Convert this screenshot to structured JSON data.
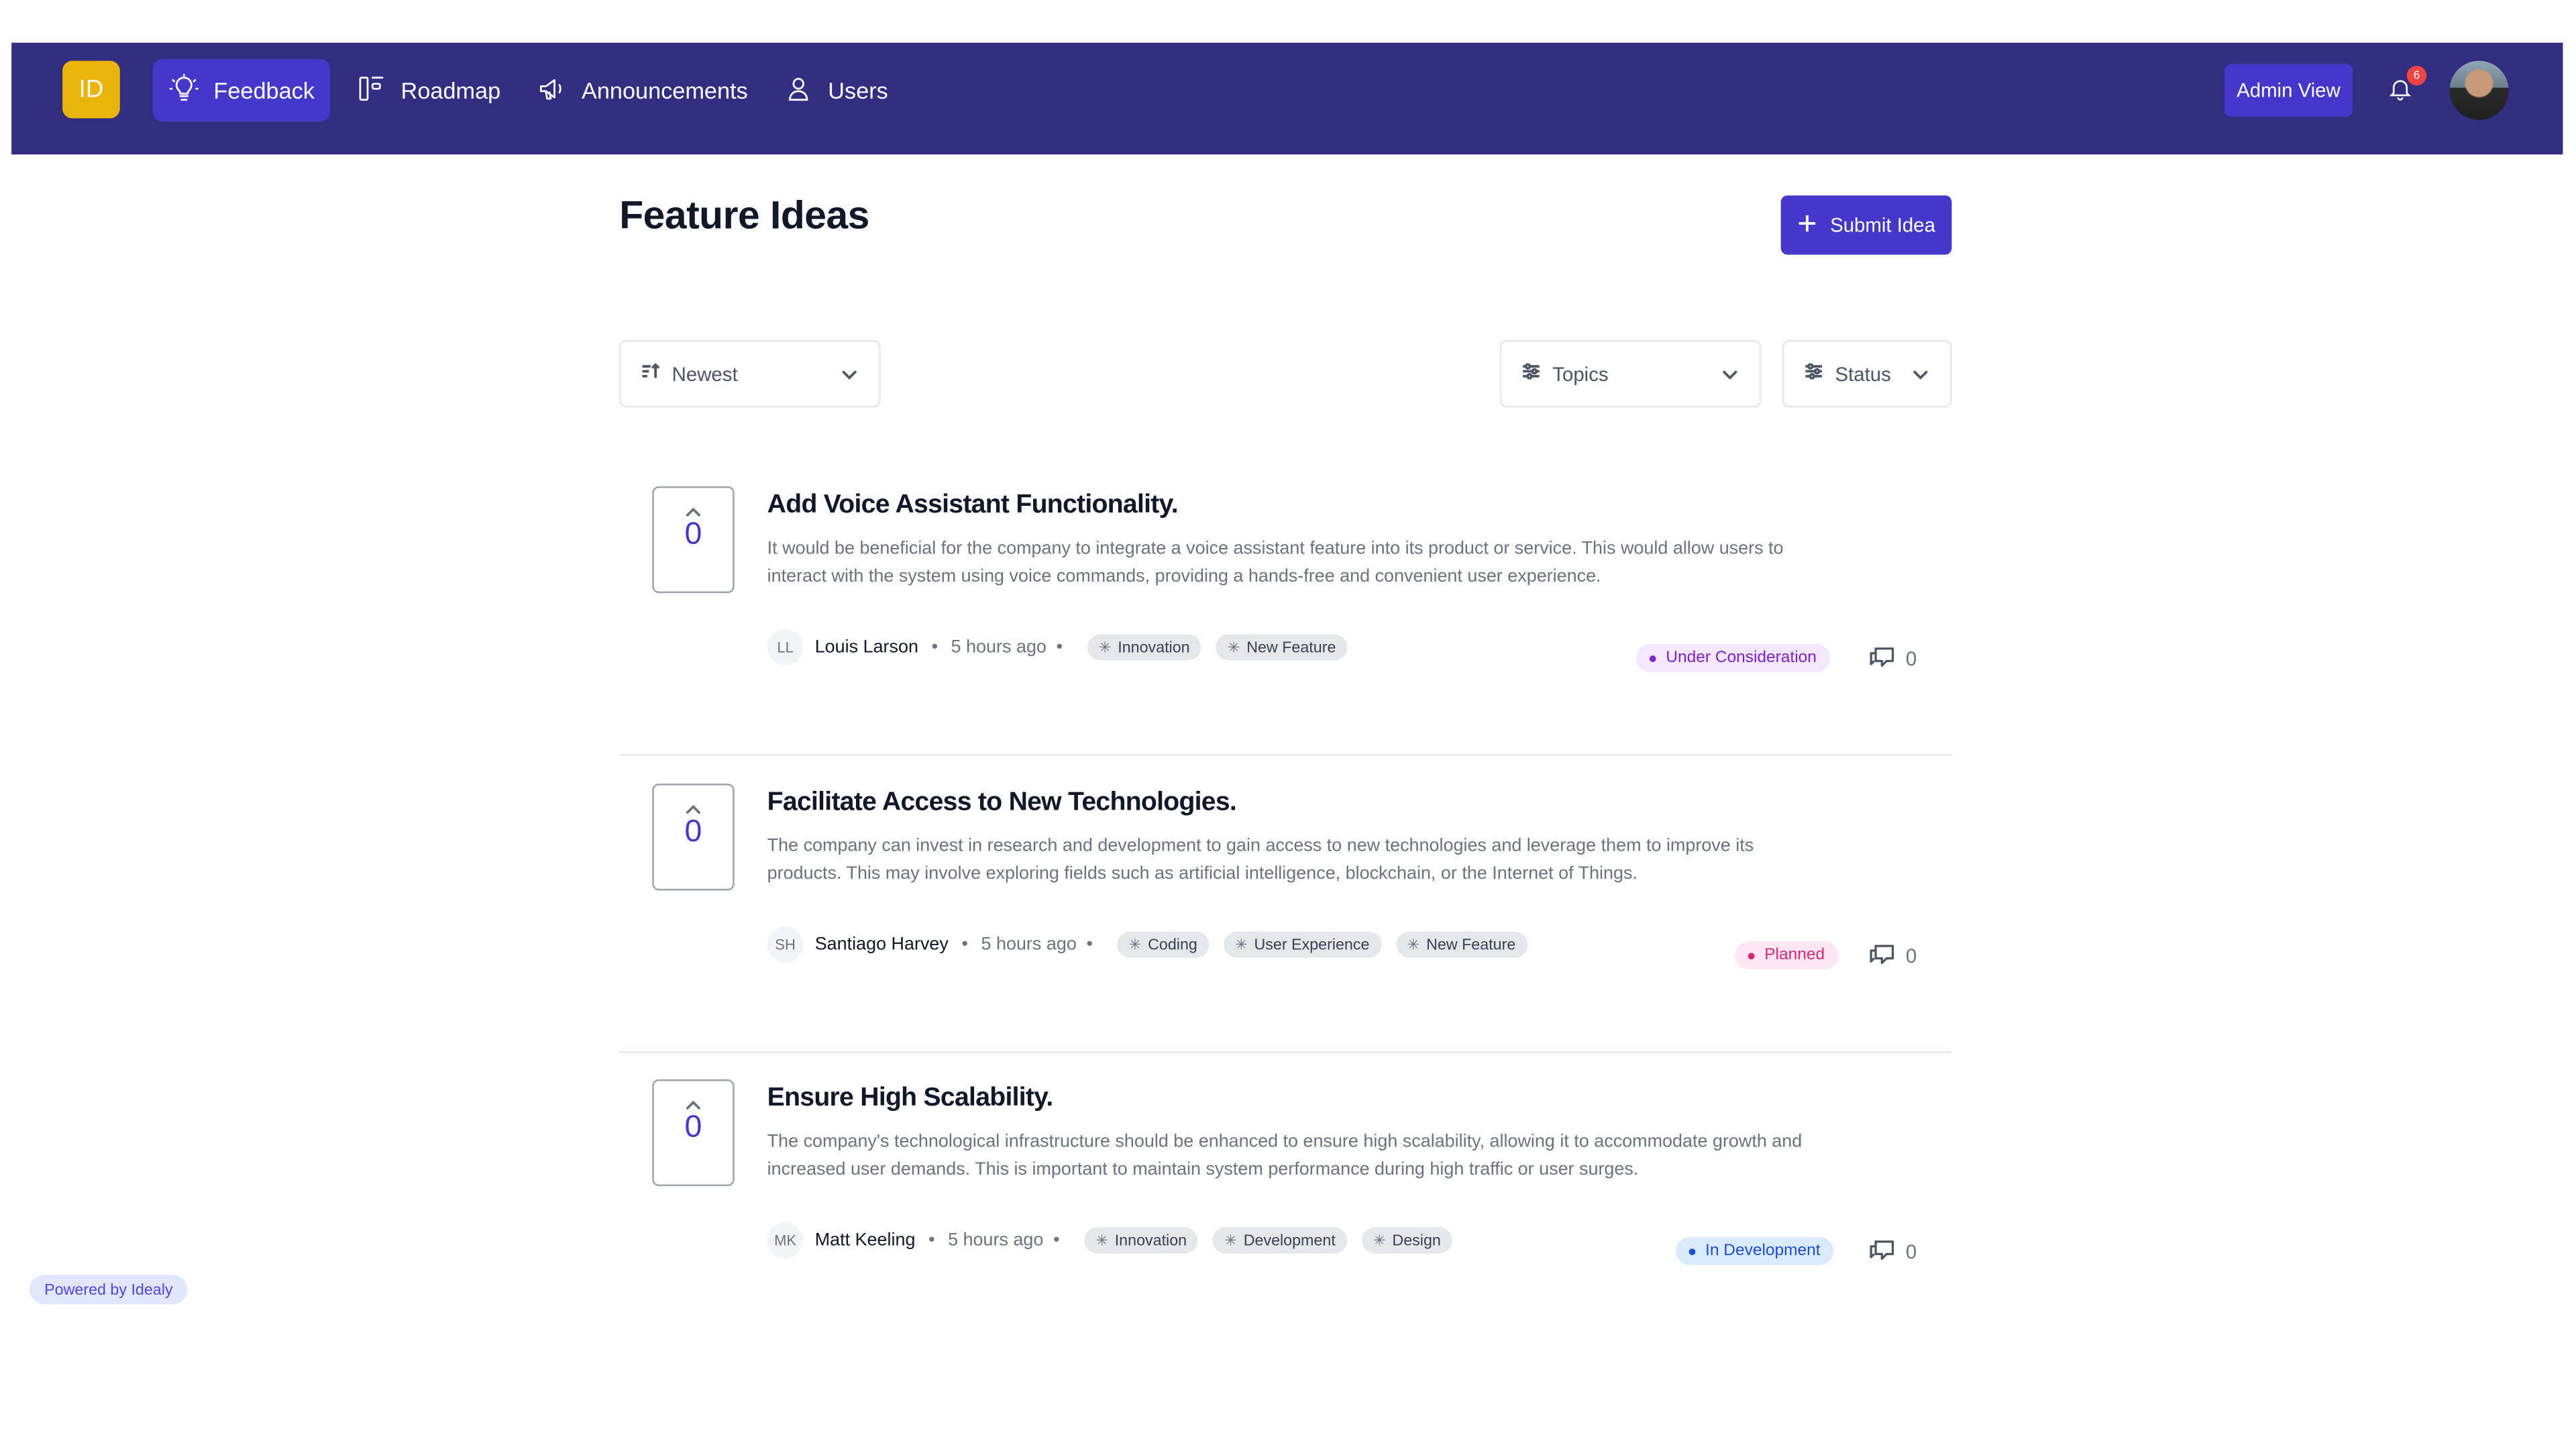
{
  "nav": {
    "logo": "ID",
    "items": [
      {
        "label": "Feedback",
        "icon": "lightbulb-icon"
      },
      {
        "label": "Roadmap",
        "icon": "roadmap-icon"
      },
      {
        "label": "Announcements",
        "icon": "megaphone-icon"
      },
      {
        "label": "Users",
        "icon": "user-icon"
      }
    ],
    "admin_label": "Admin View",
    "notification_count": "6"
  },
  "page": {
    "title": "Feature Ideas",
    "submit_label": "Submit Idea"
  },
  "filters": {
    "sort": "Newest",
    "topics": "Topics",
    "status": "Status"
  },
  "ideas": [
    {
      "votes": "0",
      "title": "Add Voice Assistant Functionality.",
      "description": "It would be beneficial for the company to integrate a voice assistant feature into its product or service. This would allow users to interact with the system using voice commands, providing a hands-free and convenient user experience.",
      "initials": "LL",
      "author": "Louis Larson",
      "time": "5 hours ago",
      "tags": [
        "Innovation",
        "New Feature"
      ],
      "status": "Under Consideration",
      "comments": "0"
    },
    {
      "votes": "0",
      "title": "Facilitate Access to New Technologies.",
      "description": "The company can invest in research and development to gain access to new technologies and leverage them to improve its products. This may involve exploring fields such as artificial intelligence, blockchain, or the Internet of Things.",
      "initials": "SH",
      "author": "Santiago Harvey",
      "time": "5 hours ago",
      "tags": [
        "Coding",
        "User Experience",
        "New Feature"
      ],
      "status": "Planned",
      "comments": "0"
    },
    {
      "votes": "0",
      "title": "Ensure High Scalability.",
      "description": "The company's technological infrastructure should be enhanced to ensure high scalability, allowing it to accommodate growth and increased user demands. This is important to maintain system performance during high traffic or user surges.",
      "initials": "MK",
      "author": "Matt Keeling",
      "time": "5 hours ago",
      "tags": [
        "Innovation",
        "Development",
        "Design"
      ],
      "status": "In Development",
      "comments": "0"
    }
  ],
  "status_colors": {
    "Under Consideration": {
      "bg": "#f3e8ff",
      "fg": "#7e22ce"
    },
    "Planned": {
      "bg": "#fce7f3",
      "fg": "#db2777"
    },
    "In Development": {
      "bg": "#dbeafe",
      "fg": "#1d4ed8"
    }
  },
  "footer": {
    "powered_by": "Powered by Idealy"
  }
}
